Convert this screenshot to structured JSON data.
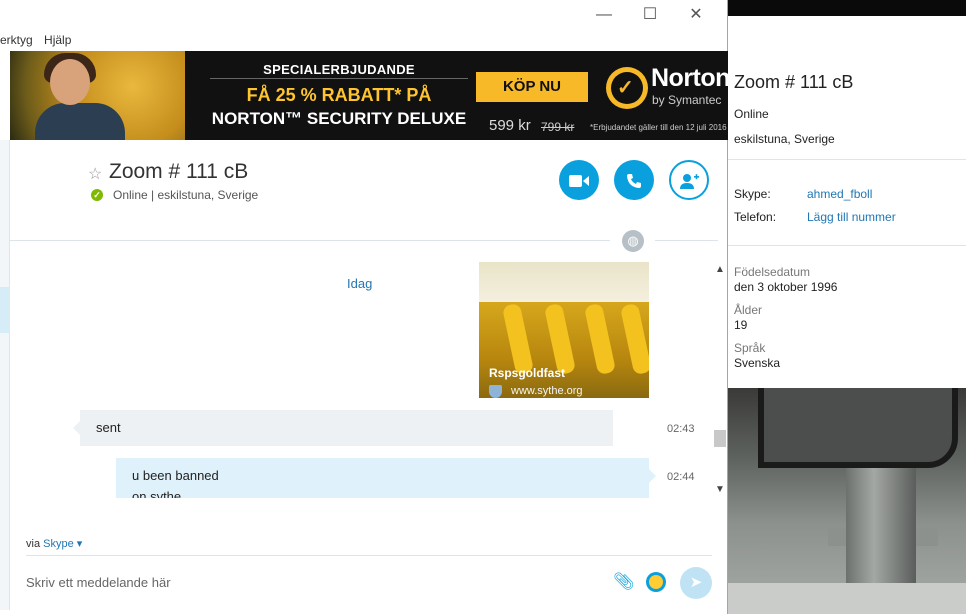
{
  "window": {
    "menu": [
      "erktyg",
      "Hjälp"
    ],
    "controls": {
      "minimize": "—",
      "maximize": "☐",
      "close": "✕"
    }
  },
  "ad": {
    "headline": "SPECIALERBJUDANDE",
    "discount": "FÅ 25 % RABATT* PÅ",
    "product": "NORTON™ SECURITY DELUXE",
    "buy_label": "KÖP NU",
    "price": "599 kr",
    "old_price": "799 kr",
    "disclaimer": "*Erbjudandet gäller till den 12 juli 2016",
    "brand": "Norton",
    "brand_sub": "by Symantec"
  },
  "conversation": {
    "contact_name": "Zoom # 111 cB",
    "status": "Online",
    "location_sep": "|",
    "location": "eskilstuna, Sverige",
    "day_label": "Idag",
    "link_preview": {
      "title": "Rspsgoldfast",
      "site": "www.sythe.org"
    },
    "messages": [
      {
        "direction": "in",
        "text": "sent",
        "time": "02:43"
      },
      {
        "direction": "out",
        "text": "u been banned",
        "text2": "on sythe",
        "time": "02:44"
      }
    ]
  },
  "composer": {
    "via_label": "via",
    "via_service": "Skype",
    "placeholder": "Skriv ett meddelande här"
  },
  "profile": {
    "name": "Zoom # 111 cB",
    "status": "Online",
    "location": "eskilstuna, Sverige",
    "skype_label": "Skype:",
    "skype_value": "ahmed_fboll",
    "phone_label": "Telefon:",
    "phone_value": "Lägg till nummer",
    "birth_label": "Födelsedatum",
    "birth_value": "den 3 oktober 1996",
    "age_label": "Ålder",
    "age_value": "19",
    "lang_label": "Språk",
    "lang_value": "Svenska"
  },
  "colors": {
    "accent": "#0aa0dd",
    "link": "#1f77b4",
    "online": "#7fba00",
    "ad_yellow": "#f7b928"
  }
}
